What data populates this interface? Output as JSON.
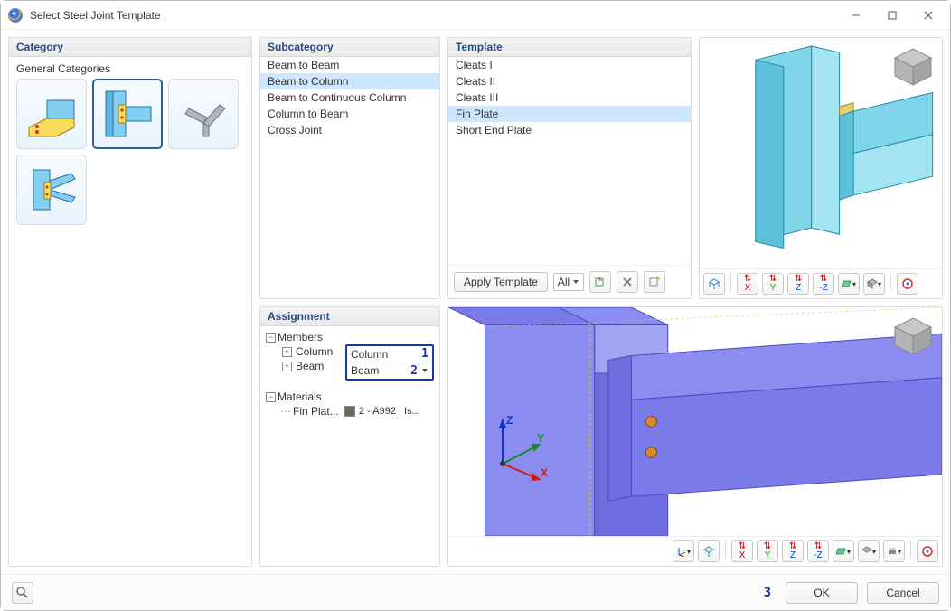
{
  "window": {
    "title": "Select Steel Joint Template"
  },
  "category": {
    "header": "Category",
    "subheading": "General Categories",
    "items": [
      {
        "name": "beam-to-beam-thumb"
      },
      {
        "name": "beam-to-column-thumb"
      },
      {
        "name": "continuous-thumb"
      },
      {
        "name": "cross-joint-thumb"
      }
    ],
    "selected_index": 1
  },
  "subcategory": {
    "header": "Subcategory",
    "items": [
      "Beam to Beam",
      "Beam to Column",
      "Beam to Continuous Column",
      "Column to Beam",
      "Cross Joint"
    ],
    "selected_index": 1
  },
  "template": {
    "header": "Template",
    "items": [
      "Cleats I",
      "Cleats II",
      "Cleats III",
      "Fin Plate",
      "Short End Plate"
    ],
    "selected_index": 3,
    "apply_label": "Apply Template",
    "filter_value": "All"
  },
  "assignment": {
    "header": "Assignment",
    "members_label": "Members",
    "materials_label": "Materials",
    "rows": [
      {
        "label": "Column",
        "value": "Column",
        "number": "1"
      },
      {
        "label": "Beam",
        "value": "Beam",
        "number": "2"
      }
    ],
    "materials": [
      {
        "label": "Fin Plat...",
        "value": "2 - A992 | Is..."
      }
    ]
  },
  "preview_toolbar": {
    "axes": [
      "X",
      "Y",
      "Z",
      "-Z"
    ]
  },
  "footer": {
    "ok": "OK",
    "cancel": "Cancel",
    "number": "3"
  }
}
